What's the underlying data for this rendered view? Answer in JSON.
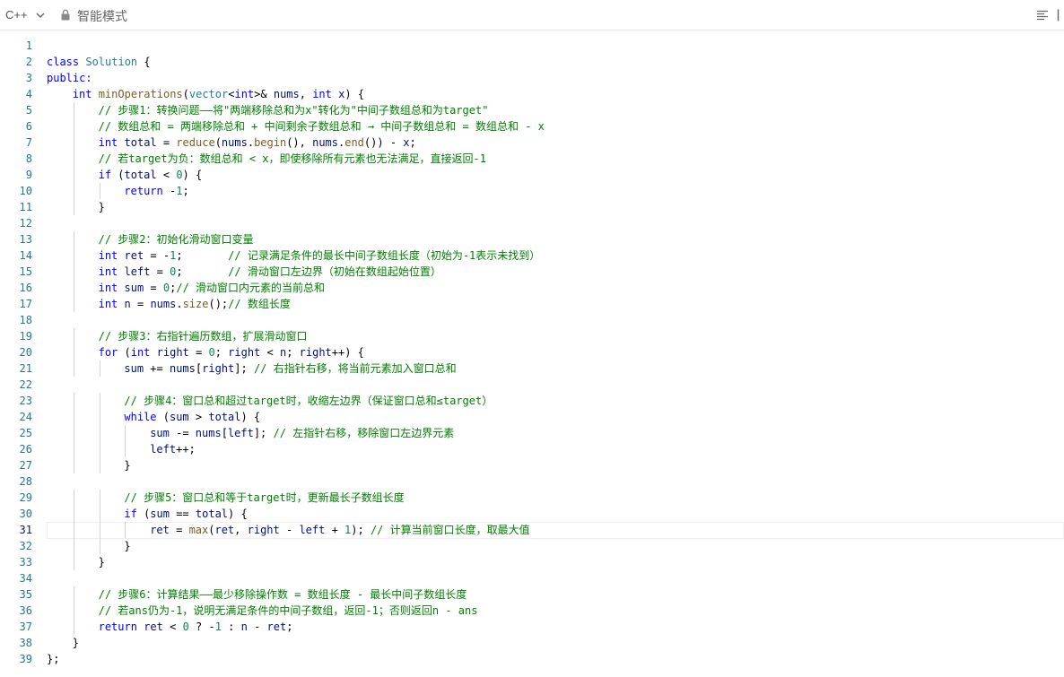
{
  "toolbar": {
    "language": "C++",
    "mode_label": "智能模式",
    "icons": [
      "chevron-down-icon",
      "lock-icon",
      "outline-menu-icon",
      "panel-icon"
    ]
  },
  "editor": {
    "current_line": 31,
    "lines": [
      {
        "n": "1",
        "indent": 0,
        "tokens": []
      },
      {
        "n": "2",
        "indent": 0,
        "tokens": [
          {
            "t": "class",
            "c": "kw"
          },
          {
            "t": " "
          },
          {
            "t": "Solution",
            "c": "ty"
          },
          {
            "t": " {"
          }
        ]
      },
      {
        "n": "3",
        "indent": 0,
        "tokens": [
          {
            "t": "public:",
            "c": "kw"
          }
        ]
      },
      {
        "n": "4",
        "indent": 1,
        "tokens": [
          {
            "t": "int",
            "c": "kw"
          },
          {
            "t": " "
          },
          {
            "t": "minOperations",
            "c": "fn"
          },
          {
            "t": "("
          },
          {
            "t": "vector",
            "c": "ty"
          },
          {
            "t": "<"
          },
          {
            "t": "int",
            "c": "kw"
          },
          {
            "t": ">& "
          },
          {
            "t": "nums",
            "c": "id"
          },
          {
            "t": ", "
          },
          {
            "t": "int",
            "c": "kw"
          },
          {
            "t": " "
          },
          {
            "t": "x",
            "c": "id"
          },
          {
            "t": ") {"
          }
        ]
      },
      {
        "n": "5",
        "indent": 2,
        "tokens": [
          {
            "t": "// 步骤1：转换问题——将\"两端移除总和为x\"转化为\"中间子数组总和为target\"",
            "c": "cm"
          }
        ]
      },
      {
        "n": "6",
        "indent": 2,
        "tokens": [
          {
            "t": "// 数组总和 = 两端移除总和 + 中间剩余子数组总和 → 中间子数组总和 = 数组总和 - x",
            "c": "cm"
          }
        ]
      },
      {
        "n": "7",
        "indent": 2,
        "tokens": [
          {
            "t": "int",
            "c": "kw"
          },
          {
            "t": " "
          },
          {
            "t": "total",
            "c": "id"
          },
          {
            "t": " = "
          },
          {
            "t": "reduce",
            "c": "fn"
          },
          {
            "t": "("
          },
          {
            "t": "nums",
            "c": "id"
          },
          {
            "t": "."
          },
          {
            "t": "begin",
            "c": "fn"
          },
          {
            "t": "(), "
          },
          {
            "t": "nums",
            "c": "id"
          },
          {
            "t": "."
          },
          {
            "t": "end",
            "c": "fn"
          },
          {
            "t": "()) - "
          },
          {
            "t": "x",
            "c": "id"
          },
          {
            "t": ";"
          }
        ]
      },
      {
        "n": "8",
        "indent": 2,
        "tokens": [
          {
            "t": "// 若target为负：数组总和 < x，即使移除所有元素也无法满足，直接返回-1",
            "c": "cm"
          }
        ]
      },
      {
        "n": "9",
        "indent": 2,
        "tokens": [
          {
            "t": "if",
            "c": "kw"
          },
          {
            "t": " ("
          },
          {
            "t": "total",
            "c": "id"
          },
          {
            "t": " < "
          },
          {
            "t": "0",
            "c": "nm"
          },
          {
            "t": ") {"
          }
        ]
      },
      {
        "n": "10",
        "indent": 3,
        "tokens": [
          {
            "t": "return",
            "c": "kw"
          },
          {
            "t": " -"
          },
          {
            "t": "1",
            "c": "nm"
          },
          {
            "t": ";"
          }
        ]
      },
      {
        "n": "11",
        "indent": 2,
        "tokens": [
          {
            "t": "}"
          }
        ]
      },
      {
        "n": "12",
        "indent": 0,
        "tokens": []
      },
      {
        "n": "13",
        "indent": 2,
        "tokens": [
          {
            "t": "// 步骤2：初始化滑动窗口变量",
            "c": "cm"
          }
        ]
      },
      {
        "n": "14",
        "indent": 2,
        "tokens": [
          {
            "t": "int",
            "c": "kw"
          },
          {
            "t": " "
          },
          {
            "t": "ret",
            "c": "id"
          },
          {
            "t": " = -"
          },
          {
            "t": "1",
            "c": "nm"
          },
          {
            "t": ";       "
          },
          {
            "t": "// 记录满足条件的最长中间子数组长度（初始为-1表示未找到）",
            "c": "cm"
          }
        ]
      },
      {
        "n": "15",
        "indent": 2,
        "tokens": [
          {
            "t": "int",
            "c": "kw"
          },
          {
            "t": " "
          },
          {
            "t": "left",
            "c": "id"
          },
          {
            "t": " = "
          },
          {
            "t": "0",
            "c": "nm"
          },
          {
            "t": ";       "
          },
          {
            "t": "// 滑动窗口左边界（初始在数组起始位置）",
            "c": "cm"
          }
        ]
      },
      {
        "n": "16",
        "indent": 2,
        "tokens": [
          {
            "t": "int",
            "c": "kw"
          },
          {
            "t": " "
          },
          {
            "t": "sum",
            "c": "id"
          },
          {
            "t": " = "
          },
          {
            "t": "0",
            "c": "nm"
          },
          {
            "t": ";"
          },
          {
            "t": "// 滑动窗口内元素的当前总和",
            "c": "cm"
          }
        ]
      },
      {
        "n": "17",
        "indent": 2,
        "tokens": [
          {
            "t": "int",
            "c": "kw"
          },
          {
            "t": " "
          },
          {
            "t": "n",
            "c": "id"
          },
          {
            "t": " = "
          },
          {
            "t": "nums",
            "c": "id"
          },
          {
            "t": "."
          },
          {
            "t": "size",
            "c": "fn"
          },
          {
            "t": "();"
          },
          {
            "t": "// 数组长度",
            "c": "cm"
          }
        ]
      },
      {
        "n": "18",
        "indent": 0,
        "tokens": []
      },
      {
        "n": "19",
        "indent": 2,
        "tokens": [
          {
            "t": "// 步骤3：右指针遍历数组，扩展滑动窗口",
            "c": "cm"
          }
        ]
      },
      {
        "n": "20",
        "indent": 2,
        "tokens": [
          {
            "t": "for",
            "c": "kw"
          },
          {
            "t": " ("
          },
          {
            "t": "int",
            "c": "kw"
          },
          {
            "t": " "
          },
          {
            "t": "right",
            "c": "id"
          },
          {
            "t": " = "
          },
          {
            "t": "0",
            "c": "nm"
          },
          {
            "t": "; "
          },
          {
            "t": "right",
            "c": "id"
          },
          {
            "t": " < "
          },
          {
            "t": "n",
            "c": "id"
          },
          {
            "t": "; "
          },
          {
            "t": "right",
            "c": "id"
          },
          {
            "t": "++) {"
          }
        ]
      },
      {
        "n": "21",
        "indent": 3,
        "tokens": [
          {
            "t": "sum",
            "c": "id"
          },
          {
            "t": " += "
          },
          {
            "t": "nums",
            "c": "id"
          },
          {
            "t": "["
          },
          {
            "t": "right",
            "c": "id"
          },
          {
            "t": "]; "
          },
          {
            "t": "// 右指针右移，将当前元素加入窗口总和",
            "c": "cm"
          }
        ]
      },
      {
        "n": "22",
        "indent": 0,
        "tokens": []
      },
      {
        "n": "23",
        "indent": 3,
        "tokens": [
          {
            "t": "// 步骤4：窗口总和超过target时，收缩左边界（保证窗口总和≤target）",
            "c": "cm"
          }
        ]
      },
      {
        "n": "24",
        "indent": 3,
        "tokens": [
          {
            "t": "while",
            "c": "kw"
          },
          {
            "t": " ("
          },
          {
            "t": "sum",
            "c": "id"
          },
          {
            "t": " > "
          },
          {
            "t": "total",
            "c": "id"
          },
          {
            "t": ") {"
          }
        ]
      },
      {
        "n": "25",
        "indent": 4,
        "tokens": [
          {
            "t": "sum",
            "c": "id"
          },
          {
            "t": " -= "
          },
          {
            "t": "nums",
            "c": "id"
          },
          {
            "t": "["
          },
          {
            "t": "left",
            "c": "id"
          },
          {
            "t": "]; "
          },
          {
            "t": "// 左指针右移，移除窗口左边界元素",
            "c": "cm"
          }
        ]
      },
      {
        "n": "26",
        "indent": 4,
        "tokens": [
          {
            "t": "left",
            "c": "id"
          },
          {
            "t": "++;"
          }
        ]
      },
      {
        "n": "27",
        "indent": 3,
        "tokens": [
          {
            "t": "}"
          }
        ]
      },
      {
        "n": "28",
        "indent": 0,
        "tokens": []
      },
      {
        "n": "29",
        "indent": 3,
        "tokens": [
          {
            "t": "// 步骤5：窗口总和等于target时，更新最长子数组长度",
            "c": "cm"
          }
        ]
      },
      {
        "n": "30",
        "indent": 3,
        "tokens": [
          {
            "t": "if",
            "c": "kw"
          },
          {
            "t": " ("
          },
          {
            "t": "sum",
            "c": "id"
          },
          {
            "t": " == "
          },
          {
            "t": "total",
            "c": "id"
          },
          {
            "t": ") {"
          }
        ]
      },
      {
        "n": "31",
        "indent": 4,
        "tokens": [
          {
            "t": "ret",
            "c": "id"
          },
          {
            "t": " = "
          },
          {
            "t": "max",
            "c": "fn"
          },
          {
            "t": "("
          },
          {
            "t": "ret",
            "c": "id"
          },
          {
            "t": ", "
          },
          {
            "t": "right",
            "c": "id"
          },
          {
            "t": " - "
          },
          {
            "t": "left",
            "c": "id"
          },
          {
            "t": " + "
          },
          {
            "t": "1",
            "c": "nm"
          },
          {
            "t": "); "
          },
          {
            "t": "// 计算当前窗口长度，取最大值",
            "c": "cm"
          }
        ]
      },
      {
        "n": "32",
        "indent": 3,
        "tokens": [
          {
            "t": "}"
          }
        ]
      },
      {
        "n": "33",
        "indent": 2,
        "tokens": [
          {
            "t": "}"
          }
        ]
      },
      {
        "n": "34",
        "indent": 0,
        "tokens": []
      },
      {
        "n": "35",
        "indent": 2,
        "tokens": [
          {
            "t": "// 步骤6：计算结果——最少移除操作数 = 数组长度 - 最长中间子数组长度",
            "c": "cm"
          }
        ]
      },
      {
        "n": "36",
        "indent": 2,
        "tokens": [
          {
            "t": "// 若ans仍为-1，说明无满足条件的中间子数组，返回-1；否则返回n - ans",
            "c": "cm"
          }
        ]
      },
      {
        "n": "37",
        "indent": 2,
        "tokens": [
          {
            "t": "return",
            "c": "kw"
          },
          {
            "t": " "
          },
          {
            "t": "ret",
            "c": "id"
          },
          {
            "t": " < "
          },
          {
            "t": "0",
            "c": "nm"
          },
          {
            "t": " ? -"
          },
          {
            "t": "1",
            "c": "nm"
          },
          {
            "t": " : "
          },
          {
            "t": "n",
            "c": "id"
          },
          {
            "t": " - "
          },
          {
            "t": "ret",
            "c": "id"
          },
          {
            "t": ";"
          }
        ]
      },
      {
        "n": "38",
        "indent": 1,
        "tokens": [
          {
            "t": "}"
          }
        ]
      },
      {
        "n": "39",
        "indent": 0,
        "tokens": [
          {
            "t": "};"
          }
        ]
      }
    ]
  }
}
